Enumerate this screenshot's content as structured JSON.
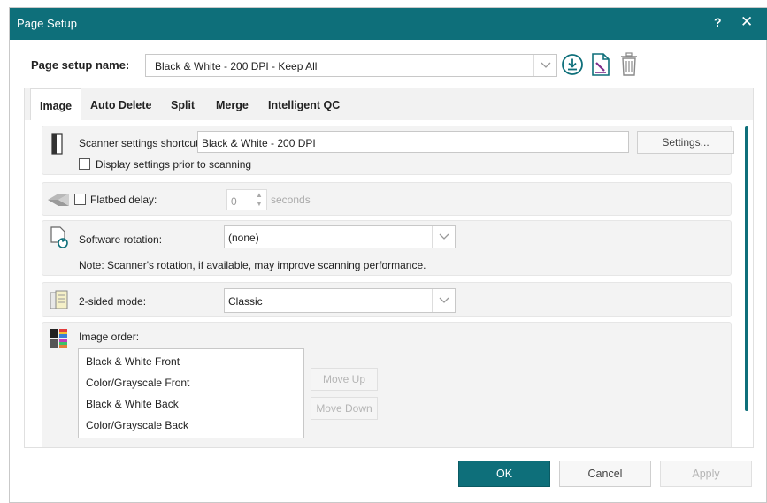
{
  "window": {
    "title": "Page Setup",
    "help": "?",
    "close": "✕"
  },
  "page_setup": {
    "label": "Page setup name:",
    "value": "Black & White - 200 DPI - Keep All",
    "icons": [
      "download-icon",
      "edit-document-icon",
      "trash-icon"
    ]
  },
  "tabs": [
    {
      "label": "Image",
      "active": true
    },
    {
      "label": "Auto Delete",
      "active": false
    },
    {
      "label": "Split",
      "active": false
    },
    {
      "label": "Merge",
      "active": false
    },
    {
      "label": "Intelligent QC",
      "active": false
    }
  ],
  "scanner": {
    "label": "Scanner settings shortcut:",
    "value": "Black & White - 200 DPI",
    "settings_button": "Settings...",
    "display_checkbox_label": "Display settings prior to scanning"
  },
  "flatbed": {
    "label": "Flatbed delay:",
    "value": "0",
    "unit": "seconds"
  },
  "rotation": {
    "label": "Software rotation:",
    "value": "(none)",
    "note": "Note: Scanner's rotation, if available, may improve scanning performance."
  },
  "two_sided": {
    "label": "2-sided mode:",
    "value": "Classic"
  },
  "image_order": {
    "label": "Image order:",
    "items": [
      "Black & White Front",
      "Color/Grayscale Front",
      "Black & White Back",
      "Color/Grayscale Back"
    ],
    "move_up": "Move Up",
    "move_down": "Move Down"
  },
  "footer": {
    "ok": "OK",
    "cancel": "Cancel",
    "apply": "Apply"
  },
  "colors": {
    "accent": "#0e6f7a",
    "page_icon": "#7b2c8a"
  }
}
